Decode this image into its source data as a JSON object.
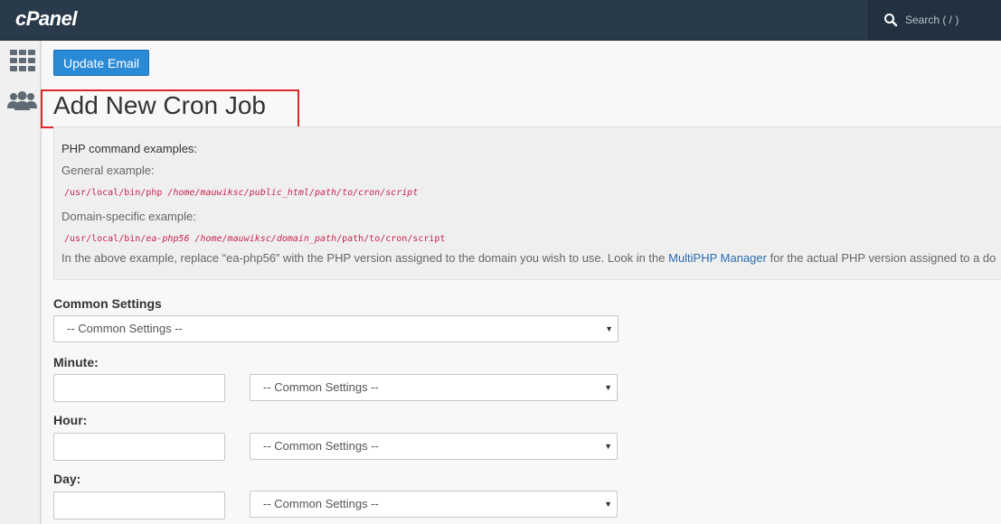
{
  "header": {
    "logo_text": "cPanel",
    "search_placeholder": "Search ( / )"
  },
  "toolbar": {
    "update_email_label": "Update Email"
  },
  "page": {
    "title": "Add New Cron Job"
  },
  "info": {
    "heading": "PHP command examples:",
    "general_label": "General example:",
    "general_cmd_prefix": "/usr/local/bin/php",
    "general_cmd_path": "/home/mauwiksc/public_html/path/to/cron/script",
    "domain_label": "Domain-specific example:",
    "domain_cmd_prefix": "/usr/local/bin/",
    "domain_cmd_version": "ea-php56",
    "domain_cmd_home": "/home/mauwiksc/domain_path",
    "domain_cmd_rest": "/path/to/cron/script",
    "note_before": "In the above example, replace “ea-php56” with the PHP version assigned to the domain you wish to use. Look in the ",
    "note_link": "MultiPHP Manager",
    "note_after": " for the actual PHP version assigned to a do"
  },
  "form": {
    "common_settings_label": "Common Settings",
    "common_settings_value": "-- Common Settings --",
    "minute_label": "Minute:",
    "minute_value": "",
    "minute_select": "-- Common Settings --",
    "hour_label": "Hour:",
    "hour_value": "",
    "hour_select": "-- Common Settings --",
    "day_label": "Day:",
    "day_value": "",
    "day_select": "-- Common Settings --"
  },
  "colors": {
    "topbar": "#293a4a",
    "accent_button": "#2b8ad6",
    "highlight_border": "#e0282b",
    "code_text": "#c7254e",
    "link": "#2a6db0"
  },
  "icons": [
    "search-icon",
    "grid-icon",
    "users-icon",
    "caret-down-icon"
  ]
}
